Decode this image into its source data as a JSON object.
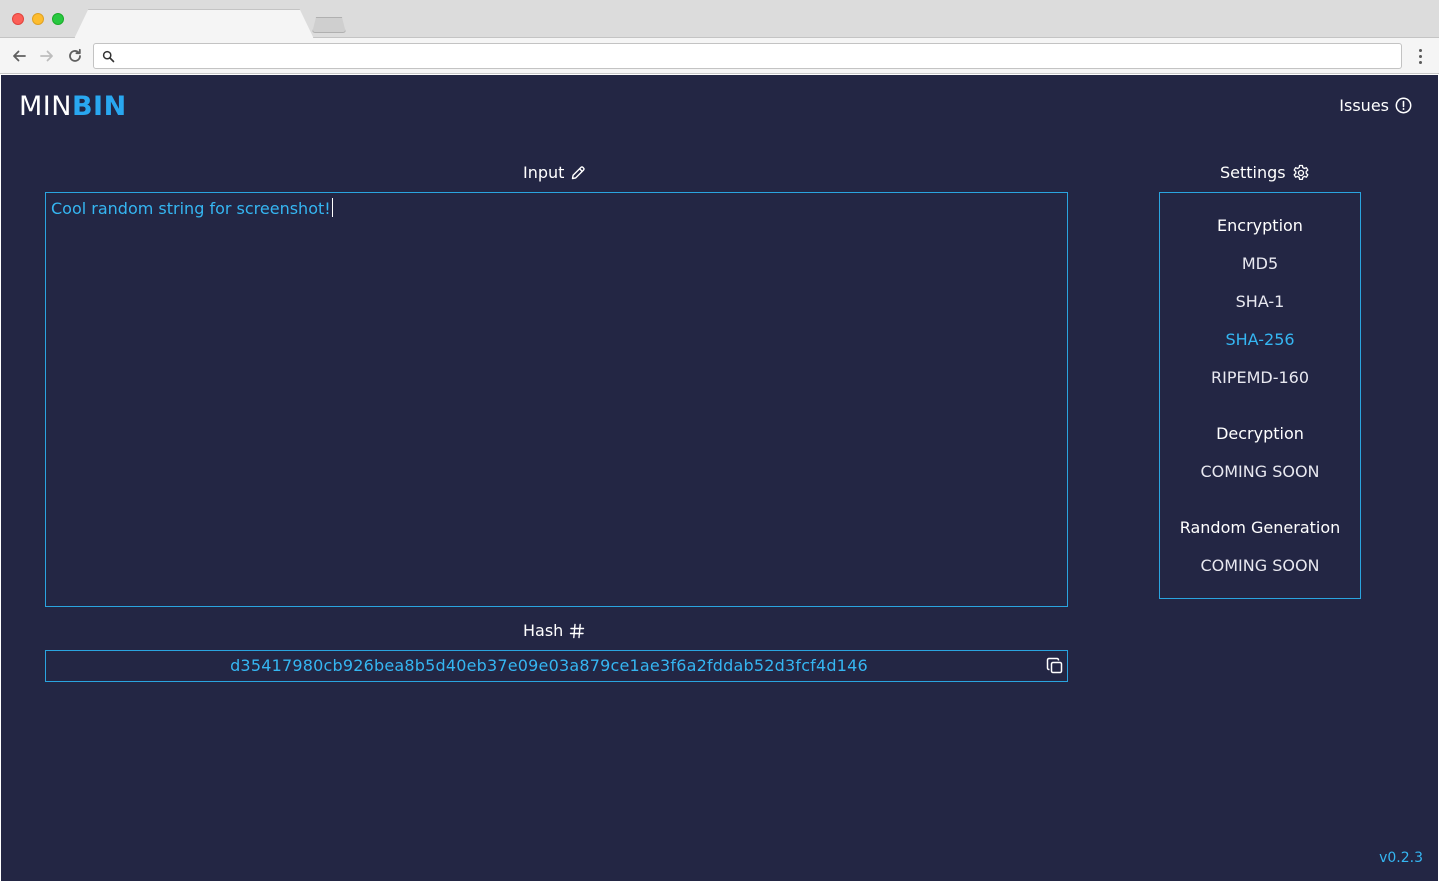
{
  "browser": {
    "address_bar_value": ""
  },
  "header": {
    "logo_min": "MIN",
    "logo_bin": "BIN",
    "issues_label": "Issues"
  },
  "input_section": {
    "title": "Input",
    "value": "Cool random string for screenshot!"
  },
  "hash_section": {
    "title": "Hash",
    "value": "d35417980cb926bea8b5d40eb37e09e03a879ce1ae3f6a2fddab52d3fcf4d146"
  },
  "settings": {
    "title": "Settings",
    "encryption": {
      "heading": "Encryption",
      "options": [
        "MD5",
        "SHA-1",
        "SHA-256",
        "RIPEMD-160"
      ],
      "selected": "SHA-256"
    },
    "decryption": {
      "heading": "Decryption",
      "status": "COMING SOON"
    },
    "random_generation": {
      "heading": "Random Generation",
      "status": "COMING SOON"
    }
  },
  "footer": {
    "version": "v0.2.3"
  },
  "colors": {
    "background": "#232644",
    "accent": "#29a7f0",
    "text": "#ffffff"
  },
  "icons": {
    "input": "pencil-icon",
    "hash": "hash-icon",
    "settings": "gear-icon",
    "issues": "alert-circle-icon",
    "copy": "copy-icon"
  }
}
